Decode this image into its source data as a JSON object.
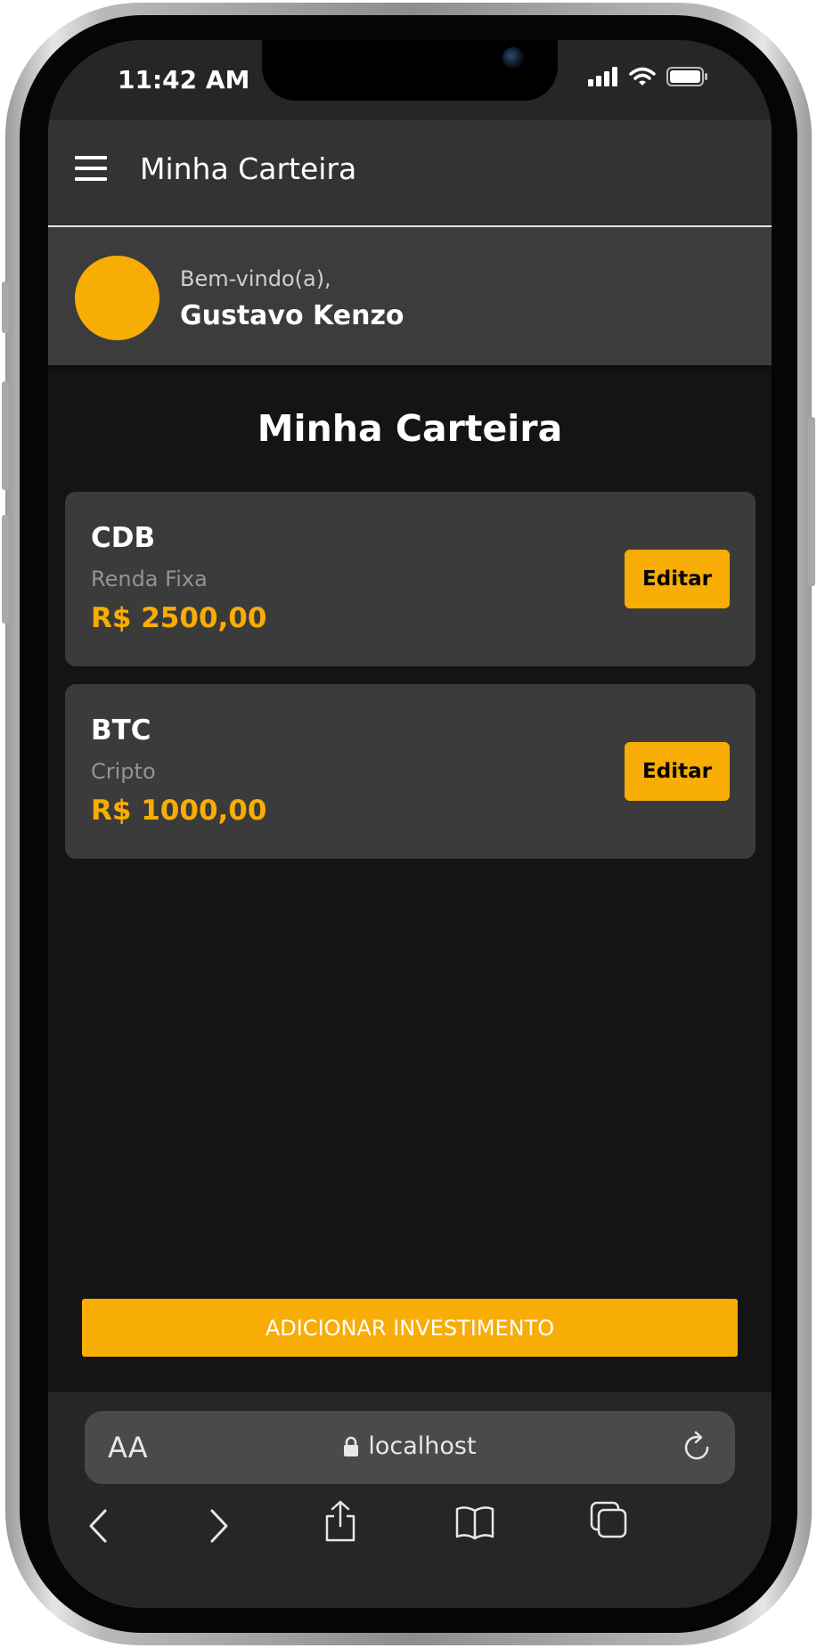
{
  "status_bar": {
    "time": "11:42 AM"
  },
  "app_bar": {
    "title": "Minha Carteira"
  },
  "user": {
    "greeting": "Bem-vindo(a),",
    "name": "Gustavo Kenzo"
  },
  "main": {
    "title": "Minha Carteira",
    "investments": [
      {
        "name": "CDB",
        "category": "Renda Fixa",
        "value": "R$ 2500,00",
        "edit_label": "Editar"
      },
      {
        "name": "BTC",
        "category": "Cripto",
        "value": "R$ 1000,00",
        "edit_label": "Editar"
      }
    ],
    "add_button": "ADICIONAR INVESTIMENTO"
  },
  "browser": {
    "text_size_label": "AA",
    "url": "localhost"
  },
  "colors": {
    "accent": "#f8ad05",
    "app_bar": "#333333",
    "card": "#3b3b3b",
    "background": "#141414"
  },
  "icons": [
    "menu-icon",
    "signal-icon",
    "wifi-icon",
    "battery-icon",
    "lock-icon",
    "reload-icon",
    "back-icon",
    "forward-icon",
    "share-icon",
    "bookmarks-icon",
    "tabs-icon"
  ]
}
